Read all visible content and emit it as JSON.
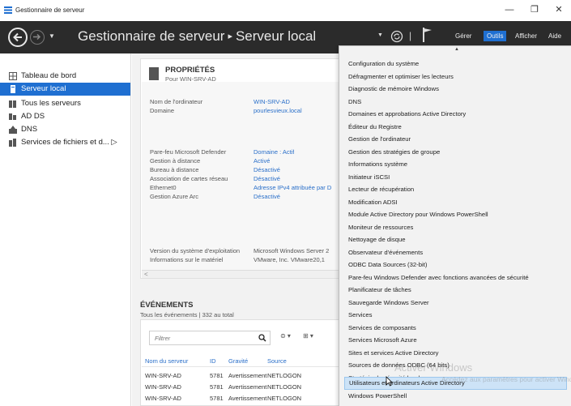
{
  "window": {
    "title": "Gestionnaire de serveur",
    "controls": [
      "—",
      "❐",
      "✕"
    ]
  },
  "header": {
    "breadcrumb_root": "Gestionnaire de serveur",
    "breadcrumb_sep": "▸",
    "breadcrumb_current": "Serveur local",
    "menus": [
      "Gérer",
      "Outils",
      "Afficher",
      "Aide"
    ],
    "active_menu": "Outils"
  },
  "sidebar": {
    "items": [
      {
        "label": "Tableau de bord",
        "icon": "dashboard-icon"
      },
      {
        "label": "Serveur local",
        "icon": "server-icon",
        "selected": true
      },
      {
        "label": "Tous les serveurs",
        "icon": "servers-icon"
      },
      {
        "label": "AD DS",
        "icon": "adds-icon"
      },
      {
        "label": "DNS",
        "icon": "dns-icon"
      },
      {
        "label": "Services de fichiers et d... ▷",
        "icon": "file-services-icon"
      }
    ]
  },
  "properties": {
    "title": "PROPRIÉTÉS",
    "subtitle": "Pour WIN-SRV-AD",
    "rows": [
      {
        "label": "Nom de l'ordinateur",
        "value": "WIN-SRV-AD",
        "link": true
      },
      {
        "label": "Domaine",
        "value": "pourlesvieux.local",
        "link": true
      },
      {
        "label": "Pare-feu Microsoft Defender",
        "value": "Domaine : Actif",
        "link": true
      },
      {
        "label": "Gestion à distance",
        "value": "Activé",
        "link": true
      },
      {
        "label": "Bureau à distance",
        "value": "Désactivé",
        "link": true
      },
      {
        "label": "Association de cartes réseau",
        "value": "Désactivé",
        "link": true
      },
      {
        "label": "Ethernet0",
        "value": "Adresse IPv4 attribuée par D",
        "link": true
      },
      {
        "label": "Gestion Azure Arc",
        "value": "Désactivé",
        "link": true
      },
      {
        "label": "Version du système d'exploitation",
        "value": "Microsoft Windows Server 2",
        "link": false
      },
      {
        "label": "Informations sur le matériel",
        "value": "VMware, Inc. VMware20,1",
        "link": false
      }
    ],
    "scroll_arrow": "<"
  },
  "events": {
    "title": "ÉVÉNEMENTS",
    "subtitle": "Tous les événements | 332 au total",
    "filter_placeholder": "Filtrer",
    "columns": [
      "Nom du serveur",
      "ID",
      "Gravité",
      "Source"
    ],
    "rows": [
      [
        "WIN-SRV-AD",
        "5781",
        "Avertissement",
        "NETLOGON"
      ],
      [
        "WIN-SRV-AD",
        "5781",
        "Avertissement",
        "NETLOGON"
      ],
      [
        "WIN-SRV-AD",
        "5781",
        "Avertissement",
        "NETLOGON"
      ]
    ]
  },
  "tools_menu": {
    "items": [
      "Configuration du système",
      "Défragmenter et optimiser les lecteurs",
      "Diagnostic de mémoire Windows",
      "DNS",
      "Domaines et approbations Active Directory",
      "Éditeur du Registre",
      "Gestion de l'ordinateur",
      "Gestion des stratégies de groupe",
      "Informations système",
      "Initiateur iSCSI",
      "Lecteur de récupération",
      "Modification ADSI",
      "Module Active Directory pour Windows PowerShell",
      "Moniteur de ressources",
      "Nettoyage de disque",
      "Observateur d'événements",
      "ODBC Data Sources (32-bit)",
      "Pare-feu Windows Defender avec fonctions avancées de sécurité",
      "Planificateur de tâches",
      "Sauvegarde Windows Server",
      "Services",
      "Services de composants",
      "Services Microsoft Azure",
      "Sites et services Active Directory",
      "Sources de données ODBC (64 bits)",
      "Stratégie de sécurité locale",
      "Utilisateurs et ordinateurs Active Directory",
      "Windows PowerShell"
    ],
    "hovered": "Utilisateurs et ordinateurs Active Directory"
  },
  "watermark": {
    "line1": "Activer Windows",
    "line2": "Accédez aux paramètres pour activer Windows."
  },
  "colors": {
    "accent": "#1f6fd1",
    "header_bg": "#2b2b2b",
    "link": "#2a6fc9",
    "hover": "#cde3f7"
  }
}
